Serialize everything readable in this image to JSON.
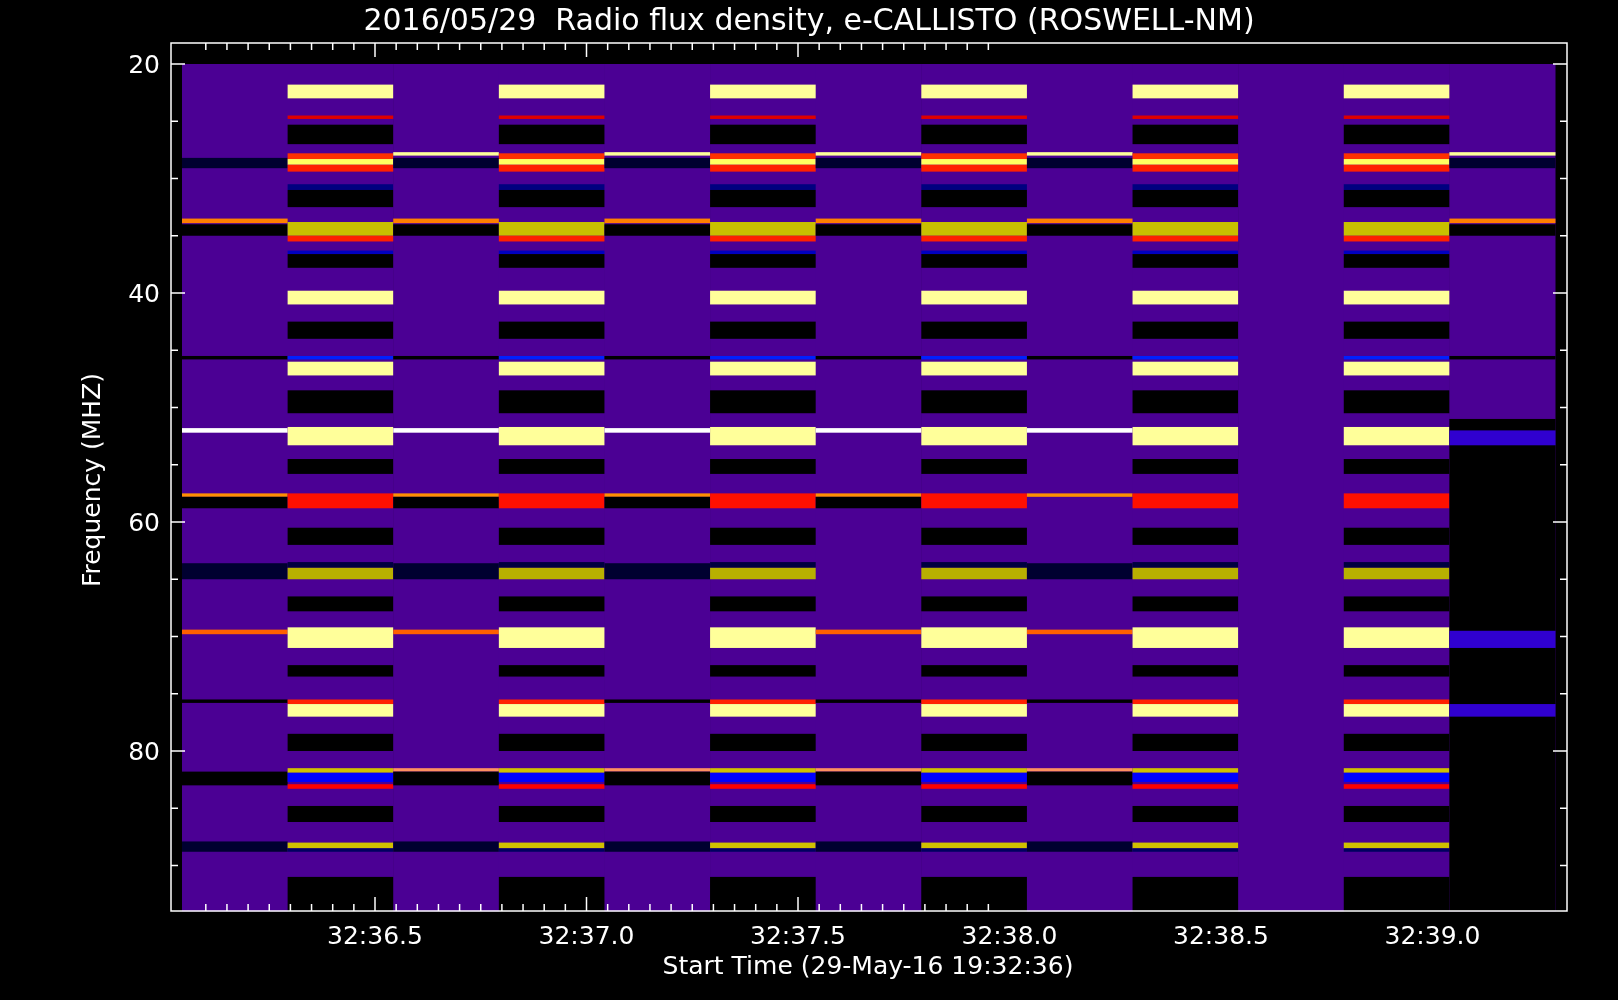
{
  "title": "2016/05/29  Radio flux density, e-CALLISTO (ROSWELL-NM)",
  "y_axis": {
    "label": "Frequency (MHZ)",
    "ticks": [
      "20",
      "40",
      "60",
      "80"
    ]
  },
  "x_axis": {
    "label": "Start Time (29-May-16 19:32:36)",
    "ticks": [
      "32:36.5",
      "32:37.0",
      "32:37.5",
      "32:38.0",
      "32:38.5",
      "32:39.0"
    ]
  }
}
